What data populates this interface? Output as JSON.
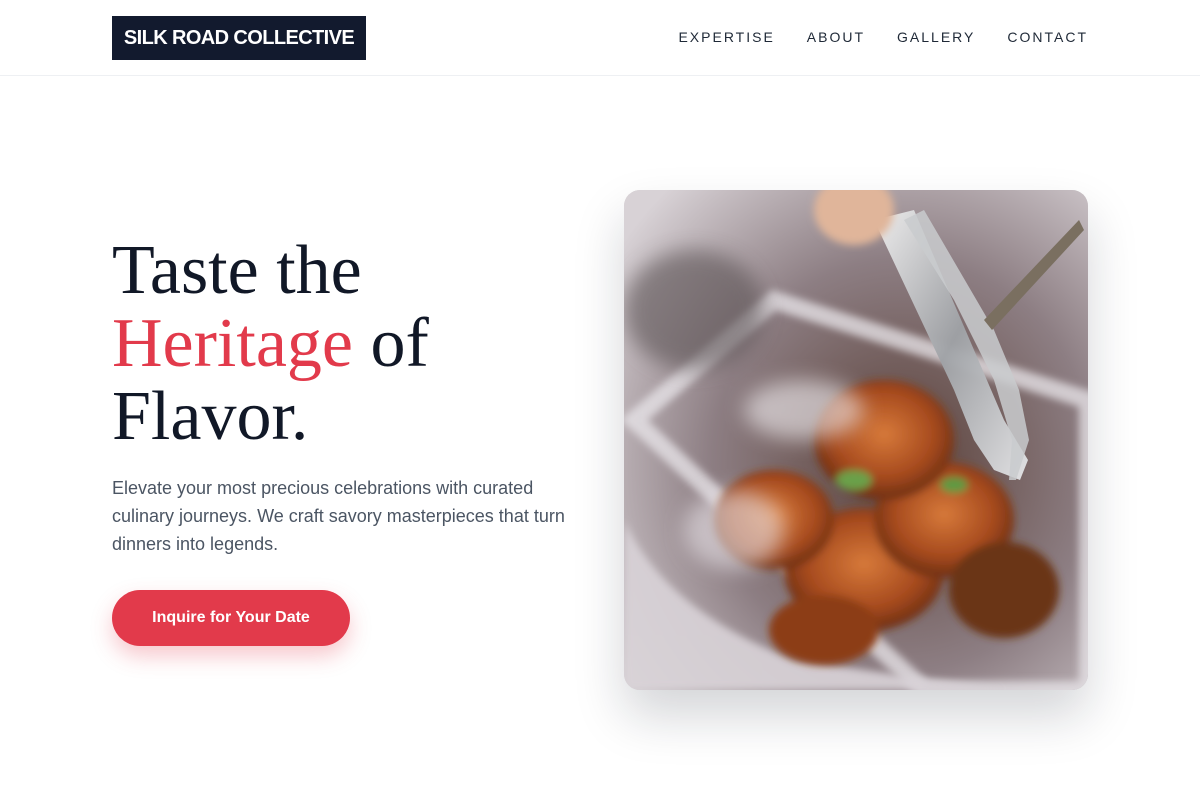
{
  "brand": {
    "name": "SILK ROAD COLLECTIVE"
  },
  "nav": {
    "items": [
      {
        "label": "EXPERTISE"
      },
      {
        "label": "ABOUT"
      },
      {
        "label": "GALLERY"
      },
      {
        "label": "CONTACT"
      }
    ]
  },
  "hero": {
    "title_line1": "Taste the",
    "title_accent": "Heritage",
    "title_line2_rest": " of",
    "title_line3": "Flavor.",
    "description": "Elevate your most precious celebrations with curated culinary journeys. We craft savory masterpieces that turn dinners into legends.",
    "cta_label": "Inquire for Your Date",
    "image_icon": "grilled-chicken-tongs-photo"
  },
  "colors": {
    "accent": "#e23a4b",
    "dark": "#121a2e",
    "text": "#111827",
    "muted": "#4b5563"
  }
}
